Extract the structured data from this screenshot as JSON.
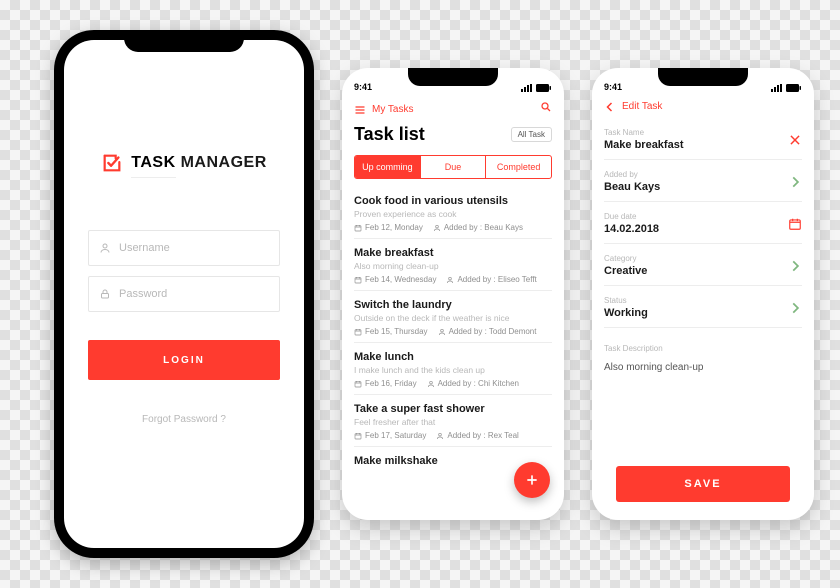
{
  "status_time": "9:41",
  "login": {
    "brand_word1": "TASK",
    "brand_word2": "MANAGER",
    "username_placeholder": "Username",
    "password_placeholder": "Password",
    "button": "LOGIN",
    "forgot": "Forgot Password ?"
  },
  "task_list": {
    "nav_label": "My Tasks",
    "title": "Task list",
    "chip": "All Task",
    "segments": {
      "upcoming": "Up comming",
      "due": "Due",
      "completed": "Completed"
    },
    "items": [
      {
        "title": "Cook food in various utensils",
        "subtitle": "Proven experience as cook",
        "date": "Feb 12, Monday",
        "added": "Added by : Beau Kays"
      },
      {
        "title": "Make breakfast",
        "subtitle": "Also morning clean-up",
        "date": "Feb 14, Wednesday",
        "added": "Added by : Eliseo Tefft"
      },
      {
        "title": "Switch the laundry",
        "subtitle": "Outside on the deck if the weather is nice",
        "date": "Feb 15, Thursday",
        "added": "Added by : Todd Demont"
      },
      {
        "title": "Make lunch",
        "subtitle": "I make lunch and the kids clean up",
        "date": "Feb 16, Friday",
        "added": "Added by : Chi Kitchen"
      },
      {
        "title": "Take a super fast shower",
        "subtitle": "Feel fresher after that",
        "date": "Feb 17, Saturday",
        "added": "Added by : Rex Teal"
      },
      {
        "title": "Make milkshake",
        "subtitle": "",
        "date": "",
        "added": ""
      }
    ]
  },
  "edit_task": {
    "nav_label": "Edit Task",
    "fields": {
      "name_label": "Task Name",
      "name_value": "Make breakfast",
      "added_label": "Added by",
      "added_value": "Beau Kays",
      "due_label": "Due date",
      "due_value": "14.02.2018",
      "cat_label": "Category",
      "cat_value": "Creative",
      "status_label": "Status",
      "status_value": "Working",
      "desc_label": "Task Description",
      "desc_value": "Also morning clean-up"
    },
    "save": "SAVE"
  }
}
